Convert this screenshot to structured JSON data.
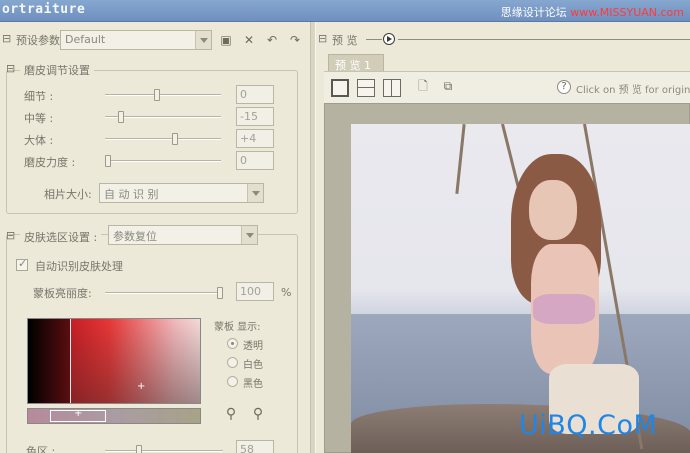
{
  "window": {
    "title": "ortraiture",
    "watermark_prefix": "思缘设计论坛",
    "watermark_url": "www.MISSYUAN.com"
  },
  "toolbar": {
    "preset_label": "预设参数:",
    "preset_value": "Default"
  },
  "smoothing": {
    "legend": "磨皮调节设置",
    "rows": [
      {
        "label": "细节 :",
        "value": "0",
        "level": 0.45
      },
      {
        "label": "中等 :",
        "value": "-15",
        "level": 0.12
      },
      {
        "label": "大体 :",
        "value": "+4",
        "level": 0.56
      },
      {
        "label": "磨皮力度 :",
        "value": "0",
        "level": 0.0
      }
    ],
    "photo_size_label": "相片大小:",
    "photo_size_value": "自 动 识 别"
  },
  "skin": {
    "legend": "皮肤选区设置 :",
    "reset_value": "参数复位",
    "auto_label": "自动识别皮肤处理",
    "opacity_label": "蒙板亮丽度:",
    "opacity_value": "100",
    "opacity_unit": "%",
    "opacity_level": 1.0,
    "mask_display_label": "蒙板 显示:",
    "mask_options": [
      "透明",
      "白色",
      "黑色"
    ],
    "hue_label": "色区 :",
    "hue_value": "58"
  },
  "preview": {
    "label": "预 览",
    "tab_label": "预 览  1",
    "hint": "Click on  预 览  for original"
  },
  "brand_watermark": "UiBQ.CoM"
}
